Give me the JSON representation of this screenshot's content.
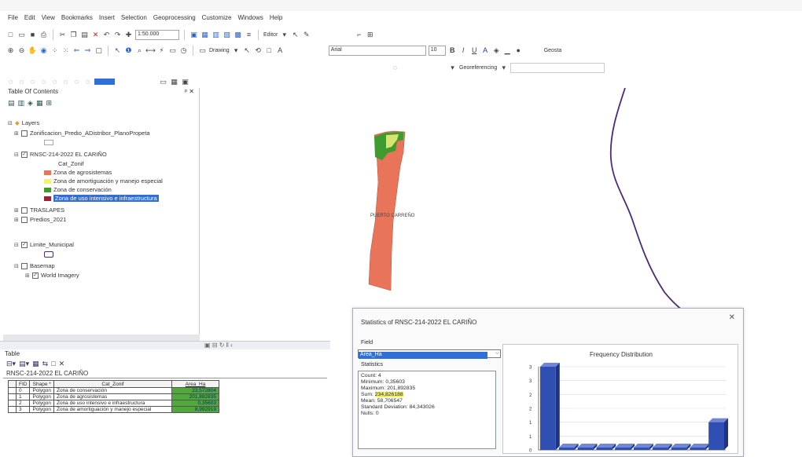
{
  "menu": [
    "File",
    "Edit",
    "View",
    "Bookmarks",
    "Insert",
    "Selection",
    "Geoprocessing",
    "Customize",
    "Windows",
    "Help"
  ],
  "toolbar1": {
    "scale": "1:50.000",
    "editor_label": "Editor"
  },
  "toolbar2": {
    "drawing_label": "Drawing",
    "font_name": "Arial",
    "font_size": "10",
    "georeferencing_label": "Georeferencing",
    "geostat_label": "Geosta"
  },
  "toc": {
    "title": "Table Of Contents",
    "layers_root": "Layers",
    "items": [
      {
        "label": "Zonificacion_Predio_ADistribor_PlanoPropeta",
        "checked": false
      },
      {
        "label": "RNSC-214-2022 EL CARIÑO",
        "checked": true
      },
      {
        "label": "Cat_Zonif"
      },
      {
        "label": "Zona de agrosistemas",
        "color": "#e8745a"
      },
      {
        "label": "Zona de amortiguación y manejo especial",
        "color": "#f5f07a"
      },
      {
        "label": "Zona de conservación",
        "color": "#3f9a2f"
      },
      {
        "label": "Zona de uso intensivo e infraestructura",
        "color": "#9b2236"
      },
      {
        "label": "TRASLAPES",
        "checked": false
      },
      {
        "label": "Predios_2021",
        "checked": false
      },
      {
        "label": "Limite_Municipal",
        "checked": true
      },
      {
        "label": "Basemap",
        "checked": false
      },
      {
        "label": "World Imagery",
        "checked": true
      }
    ]
  },
  "map": {
    "label": "PUERTO CARREÑO"
  },
  "table": {
    "title": "Table",
    "layer_name": "RNSC-214-2022 EL CARIÑO",
    "columns": [
      "FID",
      "Shape *",
      "ID",
      "Cat_Zonif",
      "Area_Ha"
    ],
    "rows": [
      [
        "0",
        "Polygon",
        "0",
        "Zona de conservación",
        "23,572804"
      ],
      [
        "1",
        "Polygon",
        "0",
        "Zona de agrosistemas",
        "201,892835"
      ],
      [
        "2",
        "Polygon",
        "0",
        "Zona de uso intensivo e infraestructura",
        "0,35603"
      ],
      [
        "3",
        "Polygon",
        "0",
        "Zona de amortiguación y manejo especial",
        "8,992919"
      ]
    ]
  },
  "stats": {
    "title": "Statistics of RNSC-214-2022 EL CARIÑO",
    "field_label": "Field",
    "field_value": "Area_Ha",
    "statistics_label": "Statistics",
    "lines": [
      {
        "k": "Count:",
        "v": "4"
      },
      {
        "k": "Minimum:",
        "v": "0,35603"
      },
      {
        "k": "Maximum:",
        "v": "201,892835"
      },
      {
        "k": "Sum:",
        "v": "234,826188"
      },
      {
        "k": "Mean:",
        "v": "58,706547"
      },
      {
        "k": "Standard Deviation:",
        "v": "84,343026"
      },
      {
        "k": "Nulls:",
        "v": "0"
      }
    ],
    "chart_title": "Frequency Distribution"
  },
  "chart_data": {
    "type": "bar",
    "title": "Frequency Distribution",
    "ylim": [
      0,
      3
    ],
    "yticks": [
      0,
      1,
      1,
      2,
      2,
      3,
      3
    ],
    "values": [
      3,
      0,
      0,
      0,
      0,
      0,
      0,
      0,
      0,
      1
    ],
    "bar_color": "#2f4fb3"
  }
}
